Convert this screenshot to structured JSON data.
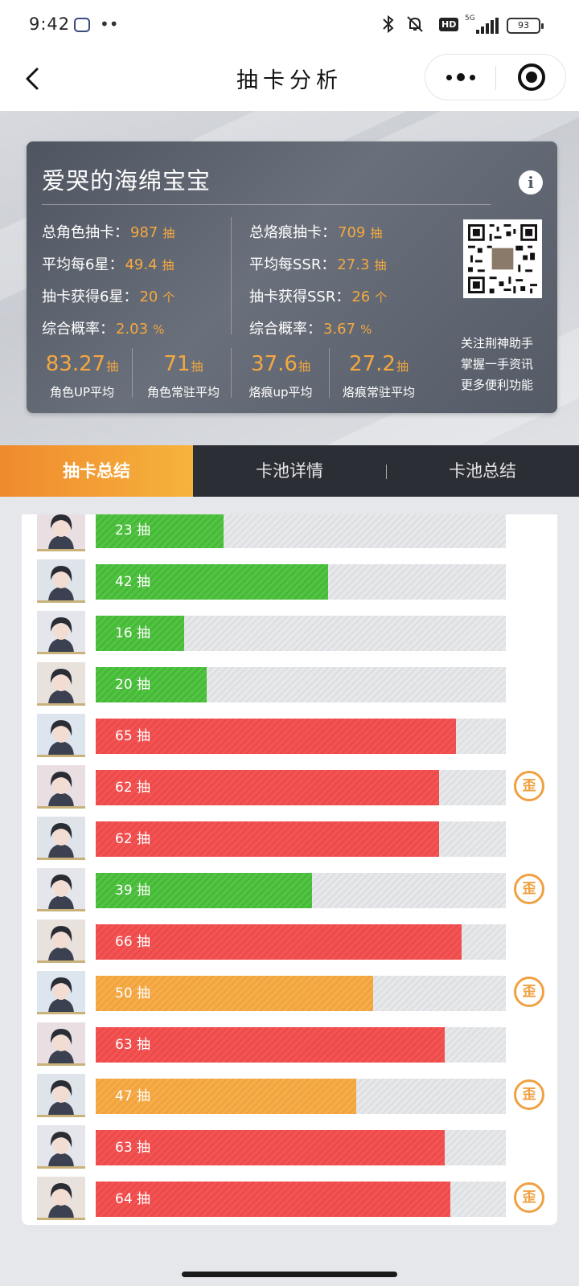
{
  "status_bar": {
    "time": "9:42",
    "dots": "••",
    "hd_badge": "HD",
    "network": "5G",
    "battery": "93"
  },
  "nav": {
    "title": "抽卡分析",
    "back_icon": "chevron-left-icon",
    "more_icon": "more-dots-icon",
    "close_icon": "target-icon"
  },
  "profile": {
    "name": "爱哭的海绵宝宝",
    "info_glyph": "i",
    "stats_left": [
      {
        "label": "总角色抽卡：",
        "value": "987",
        "unit": "抽"
      },
      {
        "label": "平均每6星：",
        "value": "49.4",
        "unit": "抽"
      },
      {
        "label": "抽卡获得6星：",
        "value": "20",
        "unit": "个"
      },
      {
        "label": "综合概率：",
        "value": "2.03",
        "unit": "%"
      }
    ],
    "stats_right": [
      {
        "label": "总烙痕抽卡：",
        "value": "709",
        "unit": "抽"
      },
      {
        "label": "平均每SSR：",
        "value": "27.3",
        "unit": "抽"
      },
      {
        "label": "抽卡获得SSR：",
        "value": "26",
        "unit": "个"
      },
      {
        "label": "综合概率：",
        "value": "3.67",
        "unit": "%"
      }
    ],
    "averages": [
      {
        "value": "83.27",
        "unit": "抽",
        "label": "角色UP平均"
      },
      {
        "value": "71",
        "unit": "抽",
        "label": "角色常驻平均"
      },
      {
        "value": "37.6",
        "unit": "抽",
        "label": "烙痕up平均"
      },
      {
        "value": "27.2",
        "unit": "抽",
        "label": "烙痕常驻平均"
      }
    ],
    "follow_lines": [
      "关注荆神助手",
      "掌握一手资讯",
      "更多便利功能"
    ]
  },
  "tabs": [
    {
      "label": "抽卡总结",
      "active": true
    },
    {
      "label": "卡池详情",
      "active": false
    },
    {
      "label": "卡池总结",
      "active": false
    }
  ],
  "pulls": {
    "unit": "抽",
    "max": 74,
    "off_banner_glyph": "歪",
    "colors": {
      "red": "#ef4a4a",
      "green": "#47b938",
      "orange": "#f2a33d"
    },
    "rows": [
      {
        "count": 23,
        "color": "green",
        "off_banner": false
      },
      {
        "count": 42,
        "color": "green",
        "off_banner": false
      },
      {
        "count": 16,
        "color": "green",
        "off_banner": false
      },
      {
        "count": 20,
        "color": "green",
        "off_banner": false
      },
      {
        "count": 65,
        "color": "red",
        "off_banner": false
      },
      {
        "count": 62,
        "color": "red",
        "off_banner": true
      },
      {
        "count": 62,
        "color": "red",
        "off_banner": false
      },
      {
        "count": 39,
        "color": "green",
        "off_banner": true
      },
      {
        "count": 66,
        "color": "red",
        "off_banner": false
      },
      {
        "count": 50,
        "color": "orange",
        "off_banner": true
      },
      {
        "count": 63,
        "color": "red",
        "off_banner": false
      },
      {
        "count": 47,
        "color": "orange",
        "off_banner": true
      },
      {
        "count": 63,
        "color": "red",
        "off_banner": false
      },
      {
        "count": 64,
        "color": "red",
        "off_banner": true
      }
    ]
  }
}
